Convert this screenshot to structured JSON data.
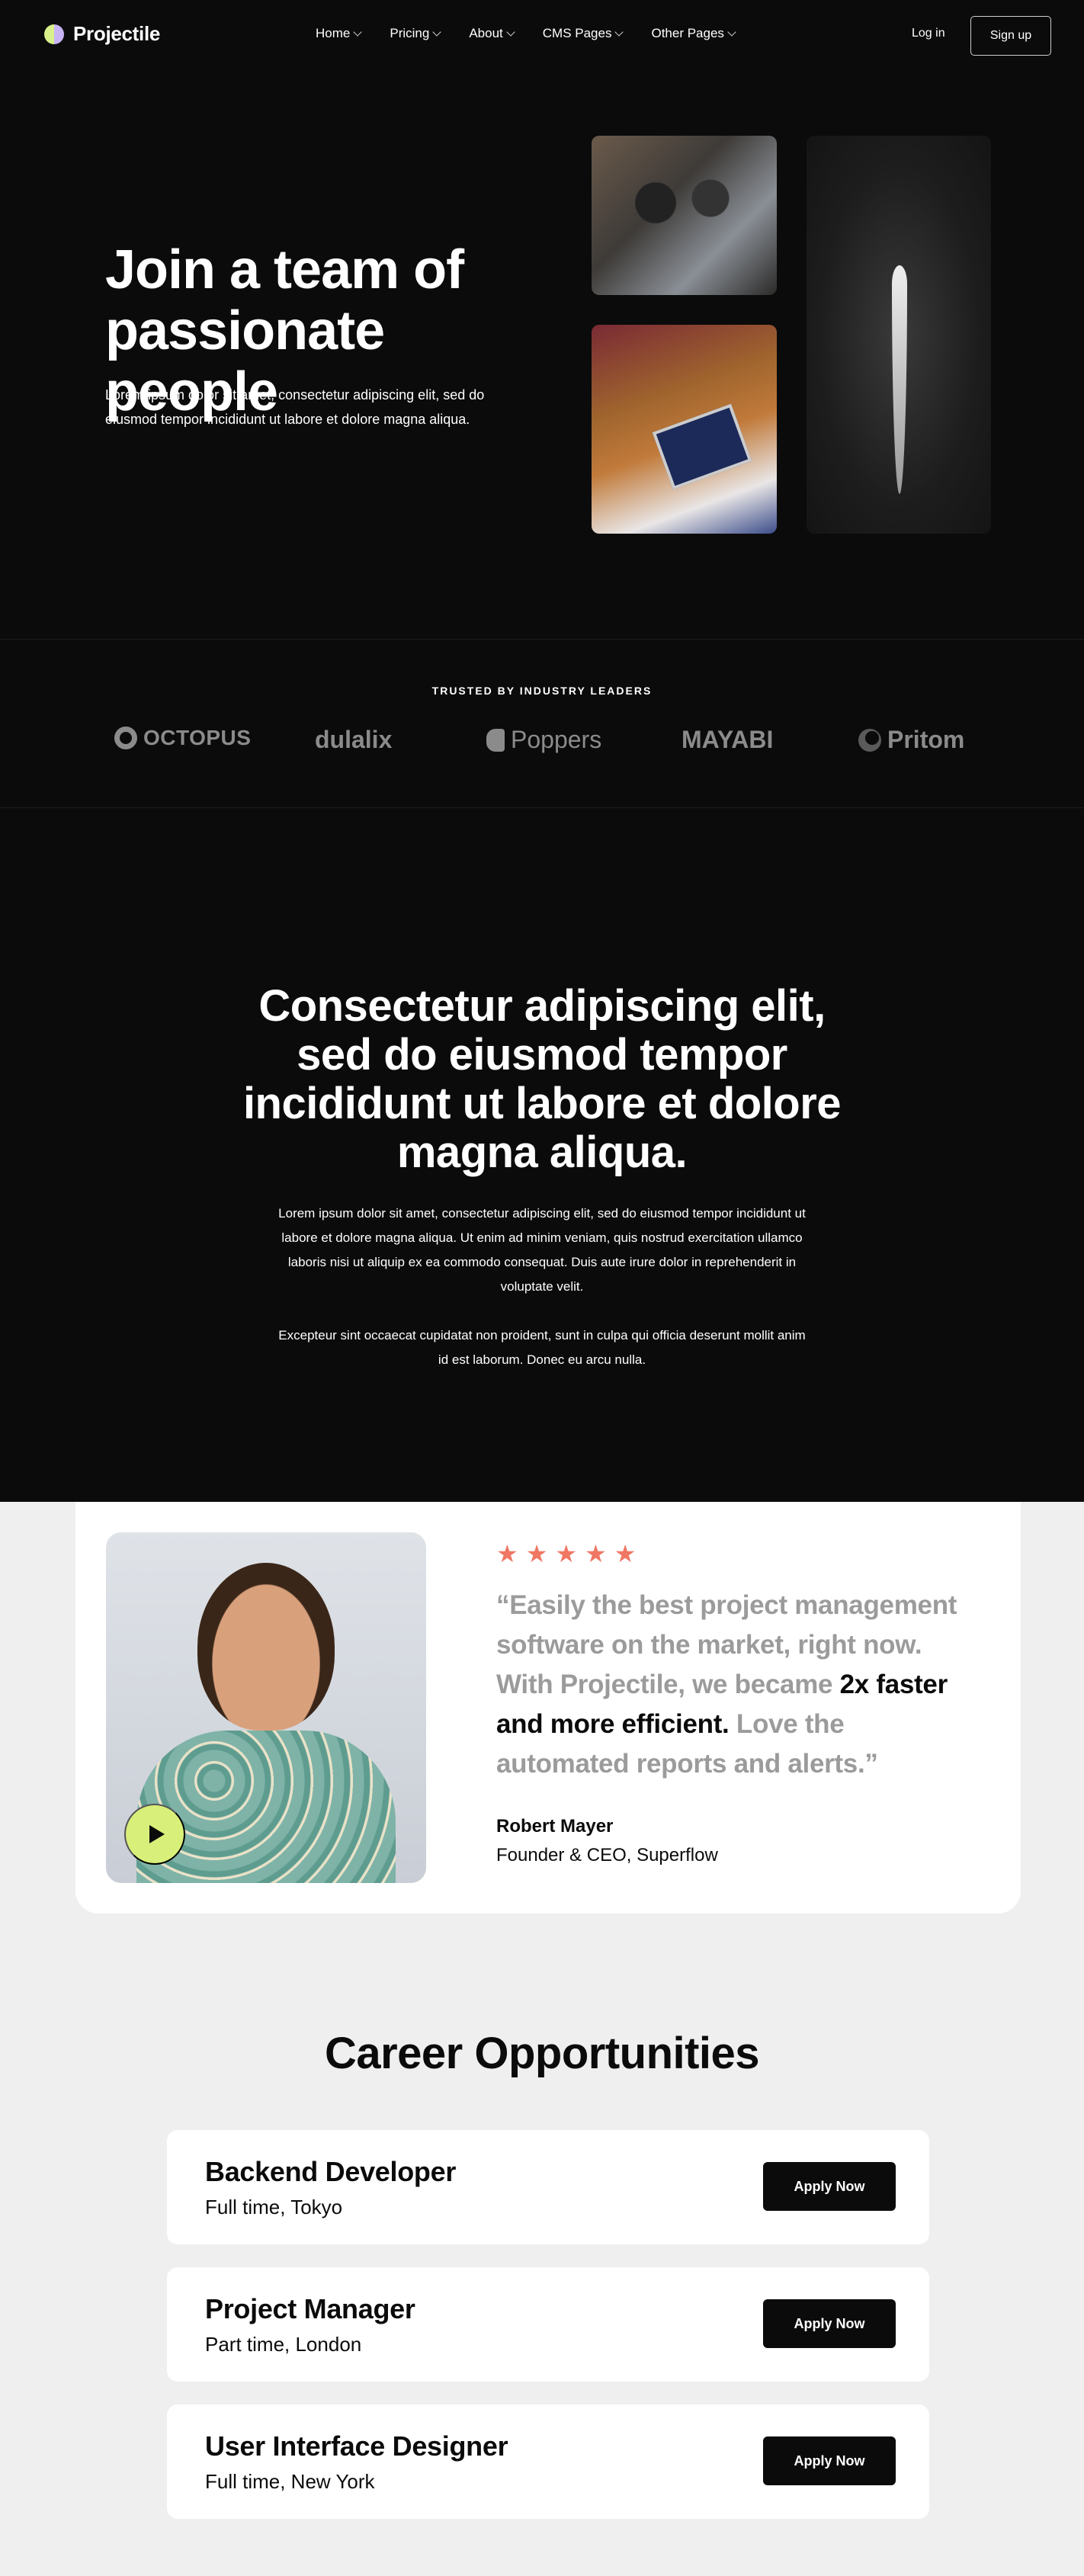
{
  "nav": {
    "brand": "Projectile",
    "links": [
      {
        "label": "Home"
      },
      {
        "label": "Pricing"
      },
      {
        "label": "About"
      },
      {
        "label": "CMS Pages"
      },
      {
        "label": "Other Pages"
      }
    ],
    "login": "Log in",
    "signup": "Sign up"
  },
  "hero": {
    "title": "Join a team of passionate people",
    "subtitle": "Lorem ipsum dolor sit amet, consectetur adipiscing elit, sed do eiusmod tempor incididunt ut labore et dolore magna aliqua."
  },
  "trusted": {
    "title": "TRUSTED BY INDUSTRY LEADERS",
    "brands": [
      "OCTOPUS",
      "dulalix",
      "Poppers",
      "MAYABI",
      "Pritom"
    ]
  },
  "statement": {
    "title": "Consectetur adipiscing elit, sed do eiusmod tempor incididunt ut labore et dolore magna aliqua.",
    "p1": "Lorem ipsum dolor sit amet, consectetur adipiscing elit, sed do eiusmod tempor incididunt ut labore et dolore magna aliqua. Ut enim ad minim veniam, quis nostrud exercitation ullamco laboris nisi ut aliquip ex ea commodo consequat. Duis aute irure dolor in reprehenderit in voluptate velit.",
    "p2": "Excepteur sint occaecat cupidatat non proident, sunt in culpa qui officia deserunt mollit anim id est laborum. Donec eu arcu nulla."
  },
  "testimonial": {
    "rating": 5,
    "quote_part1": "“Easily the best project management software on the market, right now. With Projectile, we became ",
    "quote_strong": "2x faster and more efficient.",
    "quote_part2": " Love the automated reports and alerts.”",
    "author": "Robert Mayer",
    "role": "Founder & CEO, Superflow"
  },
  "careers": {
    "title": "Career Opportunities",
    "jobs": [
      {
        "title": "Backend Developer",
        "meta": "Full time, Tokyo",
        "cta": "Apply Now"
      },
      {
        "title": "Project Manager",
        "meta": "Part time, London",
        "cta": "Apply Now"
      },
      {
        "title": "User Interface Designer",
        "meta": "Full time, New York",
        "cta": "Apply Now"
      }
    ]
  },
  "colors": {
    "dark": "#0b0b0b",
    "accent_lime": "#d8f07a",
    "star": "#f07763",
    "muted_text": "#9b9b9b",
    "page_bg": "#efefef"
  }
}
